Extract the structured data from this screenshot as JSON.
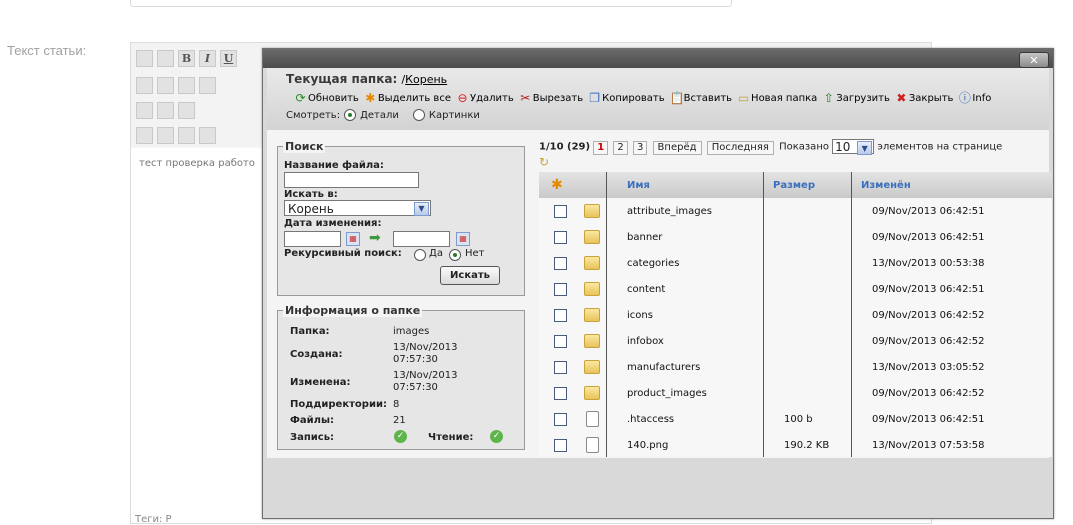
{
  "background": {
    "field_label": "Текст статьи:",
    "editor_text": "тест проверка работо",
    "tags_text": "Теги: Р",
    "toolbar_letters": [
      "B",
      "I",
      "U"
    ]
  },
  "dialog": {
    "close_label": "✕",
    "current_folder_label": "Текущая папка:",
    "current_folder_prefix": "/",
    "current_folder_link": "Корень",
    "actions": [
      {
        "label": "Обновить",
        "icon": "refresh-icon",
        "glyph": "⟳",
        "color": "#2a8a2a"
      },
      {
        "label": "Выделить все",
        "icon": "select-all-icon",
        "glyph": "✱",
        "color": "#e58a00"
      },
      {
        "label": "Удалить",
        "icon": "delete-icon",
        "glyph": "⊖",
        "color": "#d02020"
      },
      {
        "label": "Вырезать",
        "icon": "cut-icon",
        "glyph": "✂",
        "color": "#b02020"
      },
      {
        "label": "Копировать",
        "icon": "copy-icon",
        "glyph": "❐",
        "color": "#3a6fbd"
      },
      {
        "label": "Вставить",
        "icon": "paste-icon",
        "glyph": "📋",
        "color": "#a0702a"
      },
      {
        "label": "Новая папка",
        "icon": "new-folder-icon",
        "glyph": "▭",
        "color": "#c9a23a"
      },
      {
        "label": "Загрузить",
        "icon": "upload-icon",
        "glyph": "⇧",
        "color": "#2a7a2a"
      },
      {
        "label": "Закрыть",
        "icon": "close-x-icon",
        "glyph": "✖",
        "color": "#d02020"
      },
      {
        "label": "Info",
        "icon": "info-icon",
        "glyph": "ⓘ",
        "color": "#2a5fbd"
      }
    ],
    "view_label": "Смотреть:",
    "view_options": [
      "Детали",
      "Картинки"
    ],
    "search": {
      "title": "Поиск",
      "filename_label": "Название файла:",
      "filename_value": "",
      "search_in_label": "Искать в:",
      "search_in_value": "Корень",
      "date_label": "Дата изменения:",
      "recursive_label": "Рекурсивный поиск:",
      "recursive_yes": "Да",
      "recursive_no": "Нет",
      "search_button": "Искать"
    },
    "folder_info": {
      "title": "Информация о папке",
      "folder_label": "Папка:",
      "folder_value": "images",
      "created_label": "Создана:",
      "created_value_1": "13/Nov/2013",
      "created_value_2": "07:57:30",
      "modified_label": "Изменена:",
      "modified_value_1": "13/Nov/2013",
      "modified_value_2": "07:57:30",
      "subdirs_label": "Поддиректории:",
      "subdirs_value": "8",
      "files_label": "Файлы:",
      "files_value": "21",
      "write_label": "Запись:",
      "read_label": "Чтение:"
    },
    "pager": {
      "summary": "1/10 (29)",
      "pages": [
        "1",
        "2",
        "3"
      ],
      "next_label": "Вперёд",
      "last_label": "Последняя",
      "shown_label": "Показано",
      "per_page": "10",
      "tail_label": "элементов на странице"
    },
    "table": {
      "columns": [
        "Имя",
        "Размер",
        "Изменён"
      ],
      "rows": [
        {
          "name": "attribute_images",
          "size": "",
          "modified": "09/Nov/2013 06:42:51",
          "type": "folder"
        },
        {
          "name": "banner",
          "size": "",
          "modified": "09/Nov/2013 06:42:51",
          "type": "folder"
        },
        {
          "name": "categories",
          "size": "",
          "modified": "13/Nov/2013 00:53:38",
          "type": "folder"
        },
        {
          "name": "content",
          "size": "",
          "modified": "09/Nov/2013 06:42:51",
          "type": "folder"
        },
        {
          "name": "icons",
          "size": "",
          "modified": "09/Nov/2013 06:42:52",
          "type": "folder"
        },
        {
          "name": "infobox",
          "size": "",
          "modified": "09/Nov/2013 06:42:52",
          "type": "folder"
        },
        {
          "name": "manufacturers",
          "size": "",
          "modified": "13/Nov/2013 03:05:52",
          "type": "folder"
        },
        {
          "name": "product_images",
          "size": "",
          "modified": "09/Nov/2013 06:42:52",
          "type": "folder"
        },
        {
          "name": ".htaccess",
          "size": "100 b",
          "modified": "09/Nov/2013 06:42:51",
          "type": "file"
        },
        {
          "name": "140.png",
          "size": "190.2 KB",
          "modified": "13/Nov/2013 07:53:58",
          "type": "file"
        }
      ]
    }
  }
}
